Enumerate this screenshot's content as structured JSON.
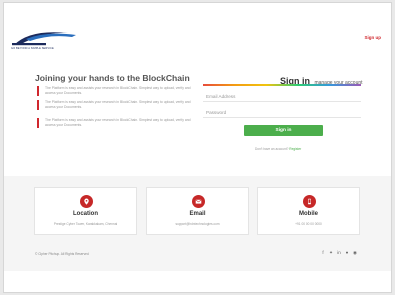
{
  "header": {
    "logo_tagline": "GO BEYOND A SIMPLE SERVICE",
    "signup_label": "Sign up"
  },
  "hero": {
    "title": "Joining your hands to the BlockChain",
    "features": [
      "The Platform is easy and assists your research in BlockChain. Simplest way to upload, verify and access your Documents.",
      "The Platform is easy and assists your research in BlockChain. Simplest way to upload, verify and access your Documents.",
      "The Platform is easy and assists your research in BlockChain. Simplest way to upload, verify and access your Documents."
    ]
  },
  "signin": {
    "title": "Sign in",
    "subtitle": "manage your account",
    "email_placeholder": "Email Address",
    "password_placeholder": "Password",
    "button_label": "Sign in",
    "register_prompt": "Don't have an account?",
    "register_link": "Register"
  },
  "contact": [
    {
      "icon": "location-pin-icon",
      "title": "Location",
      "text": "Prestige Cyber Tower, Karakkakam, Chennai"
    },
    {
      "icon": "envelope-icon",
      "title": "Email",
      "text": "support@hdntechnologies.com"
    },
    {
      "icon": "phone-icon",
      "title": "Mobile",
      "text": "+91 00 00 00 0000"
    }
  ],
  "footer": {
    "copyright": "© Cipher Pitchup. All Rights Reserved",
    "social_icons": [
      "facebook-icon",
      "twitter-icon",
      "linkedin-icon",
      "pinterest-icon",
      "skype-icon"
    ]
  },
  "colors": {
    "accent_red": "#d0282e",
    "icon_red": "#c62828",
    "signin_green": "#4cae4c"
  }
}
